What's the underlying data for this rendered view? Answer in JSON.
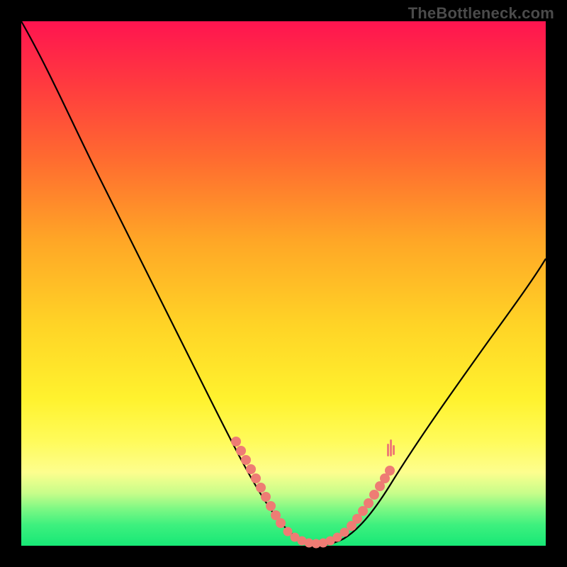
{
  "watermark": "TheBottleneck.com",
  "colors": {
    "frame": "#000000",
    "gradient_top": "#ff1450",
    "gradient_mid": "#fff22e",
    "gradient_bottom": "#17e876",
    "curve": "#000000",
    "dots": "#ee7c74"
  },
  "chart_data": {
    "type": "line",
    "title": "",
    "xlabel": "",
    "ylabel": "",
    "xlim": [
      0,
      100
    ],
    "ylim": [
      0,
      100
    ],
    "series": [
      {
        "name": "curve",
        "x": [
          0,
          5,
          10,
          15,
          20,
          25,
          30,
          35,
          40,
          45,
          48,
          50,
          55,
          60,
          62,
          65,
          70,
          75,
          80,
          85,
          90,
          95,
          100
        ],
        "y": [
          100,
          92,
          82,
          72,
          61,
          50,
          39,
          28,
          18,
          8,
          3,
          1,
          0,
          0,
          1,
          3,
          8,
          15,
          22,
          30,
          38,
          47,
          56
        ]
      }
    ],
    "highlight_ranges": [
      {
        "series": "curve",
        "x_from": 40,
        "x_to": 48
      },
      {
        "series": "curve",
        "x_from": 48,
        "x_to": 62
      },
      {
        "series": "curve",
        "x_from": 62,
        "x_to": 70
      }
    ],
    "highlight_points": {
      "left_cluster": [
        [
          40,
          18
        ],
        [
          41,
          16
        ],
        [
          42,
          14
        ],
        [
          43,
          12
        ],
        [
          44,
          10
        ],
        [
          45,
          8
        ],
        [
          46,
          6
        ],
        [
          47,
          4.5
        ],
        [
          48,
          3
        ]
      ],
      "bottom_cluster": [
        [
          49,
          2
        ],
        [
          50,
          1
        ],
        [
          52,
          0.5
        ],
        [
          54,
          0
        ],
        [
          56,
          0
        ],
        [
          58,
          0
        ],
        [
          60,
          0
        ],
        [
          61,
          0.5
        ],
        [
          62,
          1
        ]
      ],
      "right_cluster": [
        [
          63,
          2
        ],
        [
          64,
          3
        ],
        [
          65,
          4
        ],
        [
          66,
          5
        ],
        [
          67,
          6
        ],
        [
          68,
          7
        ],
        [
          69,
          8
        ],
        [
          70,
          9.5
        ]
      ]
    }
  }
}
